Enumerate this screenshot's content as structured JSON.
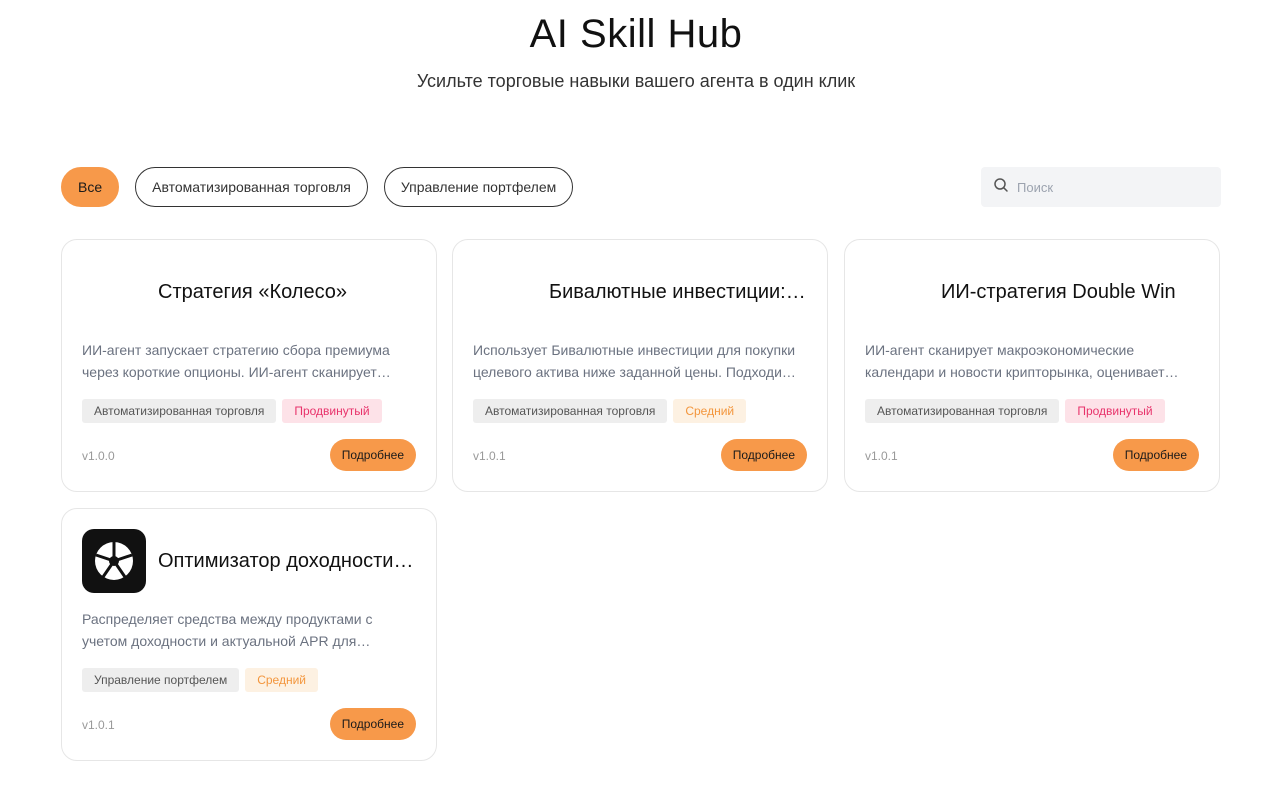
{
  "header": {
    "title": "AI Skill Hub",
    "subtitle": "Усильте торговые навыки вашего агента в один клик"
  },
  "filters": [
    {
      "label": "Все",
      "active": true
    },
    {
      "label": "Автоматизированная торговля",
      "active": false
    },
    {
      "label": "Управление портфелем",
      "active": false
    }
  ],
  "search": {
    "placeholder": "Поиск",
    "icon": "search-icon"
  },
  "colors": {
    "accent": "#f7994a",
    "advanced_tag": "#e8336b",
    "medium_tag": "#f3963d"
  },
  "cards": [
    {
      "title": "Стратегия «Колесо»",
      "description": "ИИ-агент запускает стратегию сбора премиума через короткие опционы. ИИ-агент сканирует рынок и выбирает оптимальные страйки.",
      "category": "Автоматизированная торговля",
      "level": "Продвинутый",
      "version": "v1.0.0",
      "button": "Подробнее"
    },
    {
      "title": "Бивалютные инвестиции: стратегия покупки",
      "description": "Использует Бивалютные инвестиции для покупки целевого актива ниже заданной цены. Подходит для накопления позиции.",
      "category": "Автоматизированная торговля",
      "level": "Средний",
      "version": "v1.0.1",
      "button": "Подробнее"
    },
    {
      "title": "ИИ-стратегия Double Win",
      "description": "ИИ-агент сканирует макроэкономические календари и новости крипторынка, оценивает волатильность и открывает позиции.",
      "category": "Автоматизированная торговля",
      "level": "Продвинутый",
      "version": "v1.0.1",
      "button": "Подробнее"
    },
    {
      "title": "Оптимизатор доходности Earn",
      "description": "Распределяет средства между продуктами с учетом доходности и актуальной APR для оптимизации вашего портфеля.",
      "category": "Управление портфелем",
      "level": "Средний",
      "version": "v1.0.1",
      "button": "Подробнее",
      "logo": "wheel-logo-icon"
    }
  ]
}
